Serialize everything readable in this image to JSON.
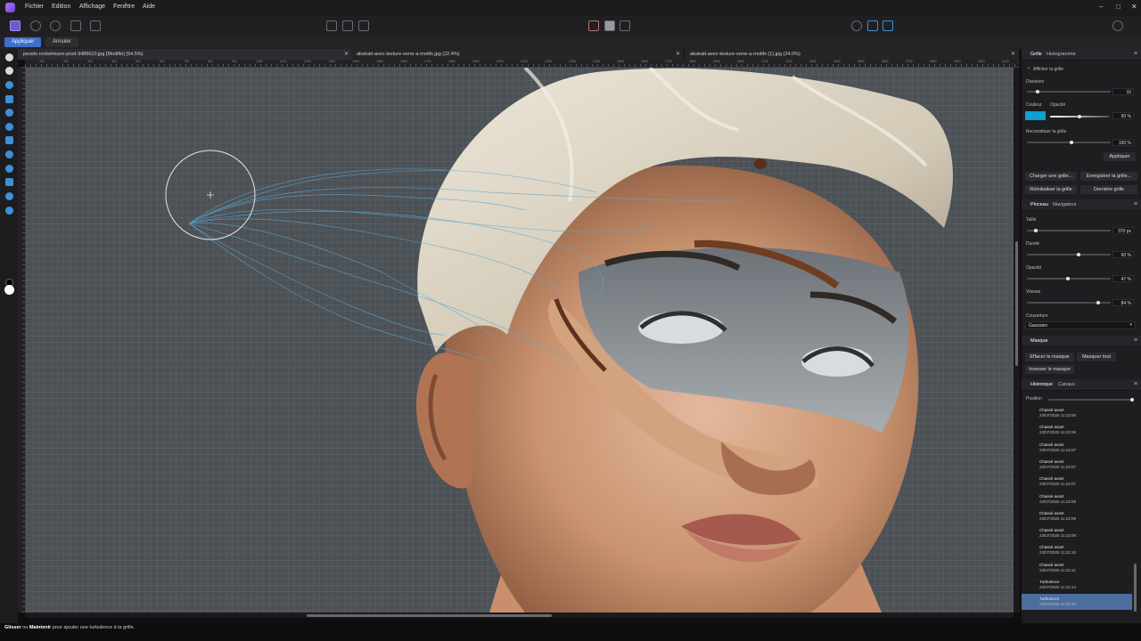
{
  "menubar": {
    "items": [
      "Fichier",
      "Edition",
      "Affichage",
      "Fenêtre",
      "Aide"
    ],
    "window_controls": [
      "–",
      "□",
      "✕"
    ]
  },
  "context_bar": {
    "apply_label": "Appliquer",
    "cancel_label": "Annuler"
  },
  "tabs": [
    {
      "label": "pexels-rocketmann-prod-9486610.jpg [Modifié] (54.5%)",
      "active": true
    },
    {
      "label": "abstrait-avec-texture-verre-a-motifs.jpg (22.4%)",
      "active": false
    },
    {
      "label": "abstrait-avec-texture-verre-a-motifs (1).jpg (24.0%)",
      "active": false
    }
  ],
  "ruler_top": [
    "100",
    "200",
    "300",
    "400",
    "500",
    "600",
    "700",
    "800",
    "900",
    "1000",
    "1100",
    "1200",
    "1300",
    "1400",
    "1500",
    "1600",
    "1700",
    "1800",
    "1900",
    "2000",
    "2100",
    "2200",
    "2300",
    "2400",
    "2500",
    "2600",
    "2700",
    "2800",
    "2900",
    "3000",
    "3100",
    "3200",
    "3300",
    "3400",
    "3500",
    "3600",
    "3700",
    "3800",
    "3900",
    "4000",
    "4100"
  ],
  "grid_panel": {
    "tabs": [
      "Grille",
      "Histogramme"
    ],
    "show_grid_label": "Afficher la grille",
    "show_grid_checked": true,
    "divisions_label": "Divisions",
    "divisions_value": "10",
    "color_label": "Couleur",
    "opacity_label": "Opacité",
    "opacity_value": "50 %",
    "grid_color": "#0aa0cf",
    "reconstruct_label": "Reconstituer la grille",
    "reconstruct_value": "100 %",
    "apply_label": "Appliquer",
    "load_label": "Charger une grille...",
    "save_label": "Enregistrer la grille...",
    "reset_label": "Réinitialiser la grille",
    "last_label": "Dernière grille"
  },
  "brush_panel": {
    "tabs": [
      "Pinceau",
      "Navigateur"
    ],
    "size_label": "Taille",
    "size_value": "370 px",
    "hardness_label": "Dureté",
    "hardness_value": "60 %",
    "opacity_label": "Opacité",
    "opacity_value": "47 %",
    "speed_label": "Vitesse",
    "speed_value": "84 %",
    "coverage_label": "Couverture",
    "coverage_value": "Gaussien"
  },
  "mask_panel": {
    "title": "Masque",
    "clear_label": "Effacer le masque",
    "mask_all_label": "Masquer tout",
    "invert_label": "Inverser le masque"
  },
  "history_panel": {
    "tabs": [
      "Historique",
      "Canaux"
    ],
    "position_label": "Position",
    "items": [
      {
        "title": "Chassé avant",
        "date": "23/07/2025 11:22:06"
      },
      {
        "title": "Chassé avant",
        "date": "23/07/2025 11:22:06"
      },
      {
        "title": "Chassé avant",
        "date": "23/07/2025 11:22:07"
      },
      {
        "title": "Chassé avant",
        "date": "23/07/2025 11:22:07"
      },
      {
        "title": "Chassé avant",
        "date": "23/07/2025 11:22:07"
      },
      {
        "title": "Chassé avant",
        "date": "23/07/2025 11:22:08"
      },
      {
        "title": "Chassé avant",
        "date": "23/07/2025 11:22:09"
      },
      {
        "title": "Chassé avant",
        "date": "23/07/2025 11:22:09"
      },
      {
        "title": "Chassé avant",
        "date": "23/07/2025 11:22:10"
      },
      {
        "title": "Chassé avant",
        "date": "23/07/2025 11:22:11"
      },
      {
        "title": "Turbulence",
        "date": "23/07/2025 11:22:14"
      },
      {
        "title": "Turbulence",
        "date": "23/07/2025 11:22:14"
      }
    ]
  },
  "status": {
    "key1": "Glisser",
    "joiner": " ou ",
    "key2": "Maintenir",
    "rest": " pour ajouter une turbulence à la grille."
  }
}
